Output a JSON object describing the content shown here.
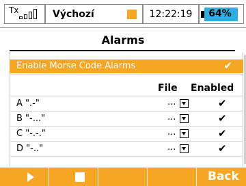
{
  "statusbar": {
    "tx_label": "Tx",
    "model_name": "Výchozí",
    "time": "12:22:19",
    "battery_percent": "64%",
    "accent_color": "#f5a623",
    "battery_color": "#2bb0e6"
  },
  "page": {
    "title": "Alarms"
  },
  "enable_row": {
    "label": "Enable Morse Code Alarms",
    "checked": true,
    "check_glyph": "✔"
  },
  "columns": {
    "file": "File",
    "enabled": "Enabled"
  },
  "alarms": [
    {
      "name": "A \".-\"",
      "file": "...",
      "enabled_glyph": "✔"
    },
    {
      "name": "B \"-...\"",
      "file": "...",
      "enabled_glyph": "✔"
    },
    {
      "name": "C \"-.-.\"",
      "file": "...",
      "enabled_glyph": "✔"
    },
    {
      "name": "D \"-..\"",
      "file": "...",
      "enabled_glyph": "✔"
    }
  ],
  "softkeys": {
    "f1_icon": "play-icon",
    "f2_icon": "stop-icon",
    "f5_label": "Back"
  }
}
